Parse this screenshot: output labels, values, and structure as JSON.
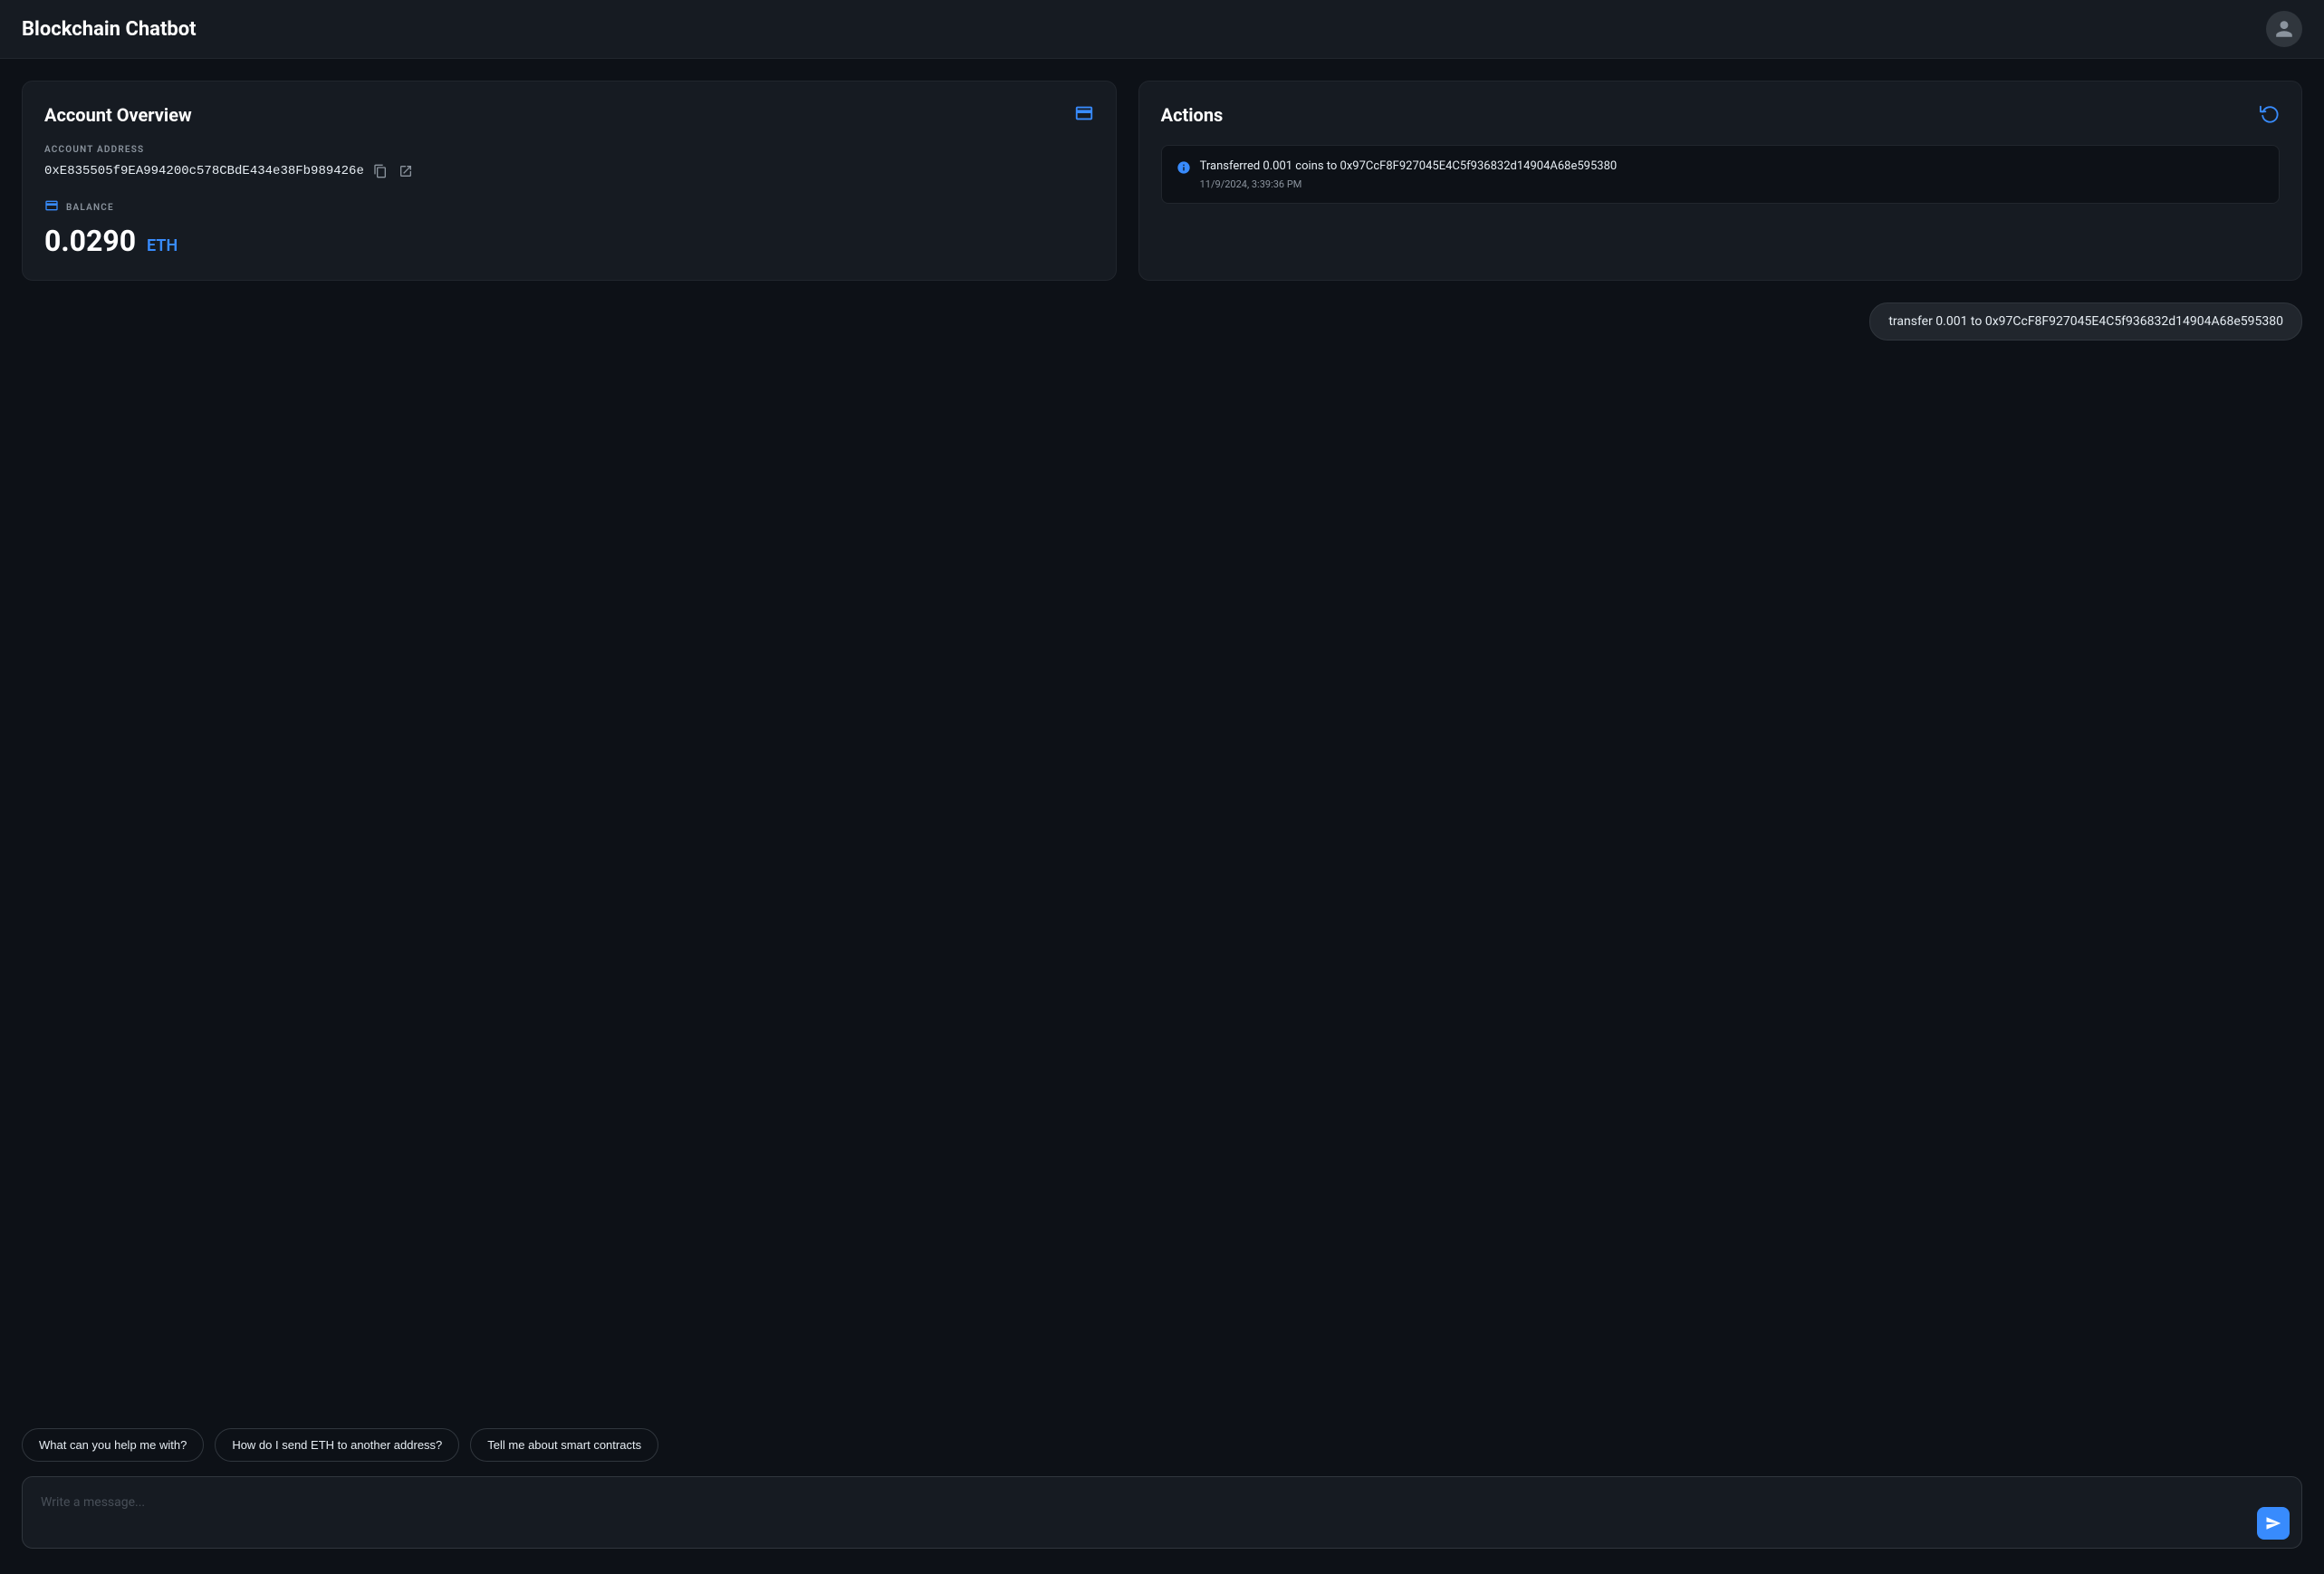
{
  "header": {
    "title": "Blockchain Chatbot"
  },
  "account_overview": {
    "title": "Account Overview",
    "address_label": "ACCOUNT ADDRESS",
    "address": "0xE835505f9EA994200c578CBdE434e38Fb989426e",
    "balance_label": "BALANCE",
    "balance_amount": "0.0290",
    "balance_currency": "ETH"
  },
  "actions": {
    "title": "Actions",
    "transaction": {
      "description": "Transferred 0.001 coins to 0x97CcF8F927045E4C5f936832d14904A68e595380",
      "timestamp": "11/9/2024, 3:39:36 PM"
    }
  },
  "messages": [
    {
      "text": "transfer 0.001 to 0x97CcF8F927045E4C5f936832d14904A68e595380",
      "type": "user"
    }
  ],
  "suggestions": [
    {
      "label": "What can you help me with?"
    },
    {
      "label": "How do I send ETH to another address?"
    },
    {
      "label": "Tell me about smart contracts"
    }
  ],
  "input": {
    "placeholder": "Write a message..."
  }
}
